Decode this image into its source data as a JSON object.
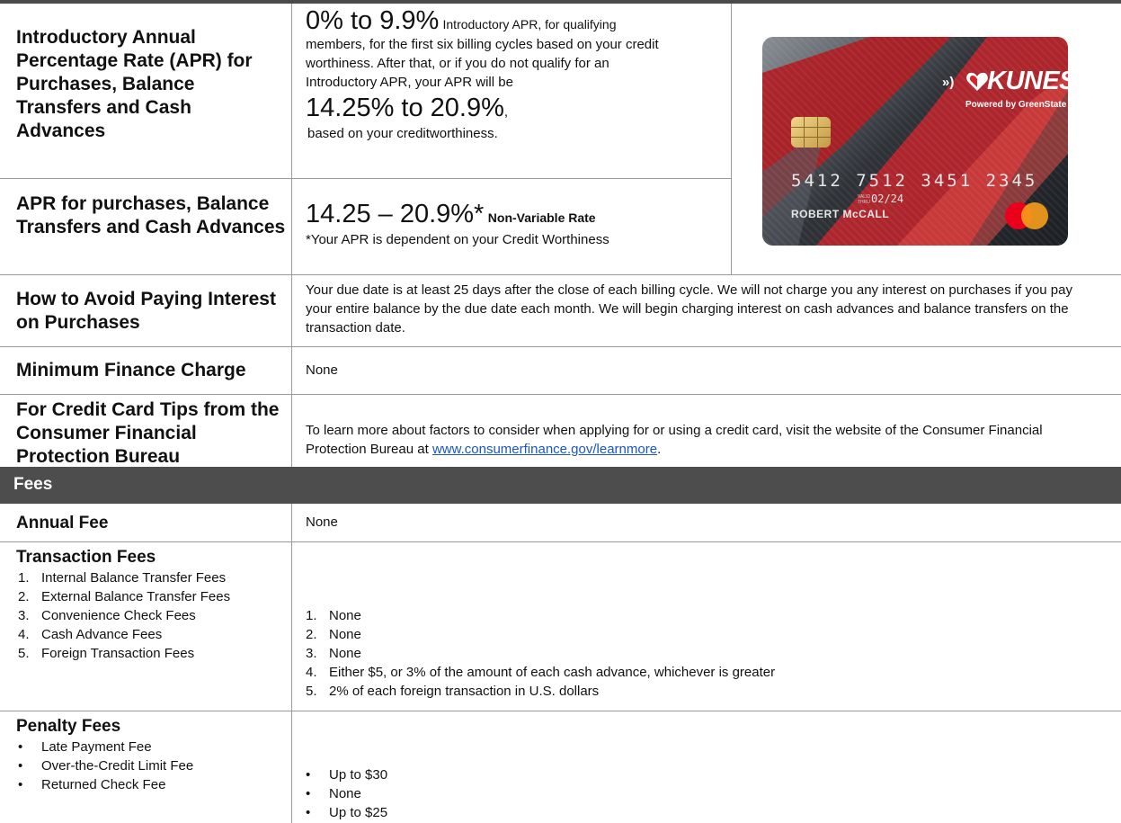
{
  "intro_apr": {
    "label": "Introductory Annual Percentage Rate (APR) for Purchases, Balance Transfers and Cash Advances",
    "rate": "0% to 9.9%",
    "text1": "Introductory APR, for qualifying",
    "text2": "members, for the first six billing cycles based on your credit",
    "text3": "worthiness. After that, or if you do not qualify for an",
    "text4": "Introductory APR, your APR will be",
    "rate2": "14.25% to 20.9%",
    "rate2_suffix": ",",
    "text5": "based on your creditworthiness."
  },
  "apr": {
    "label": "APR for purchases, Balance Transfers and Cash Advances",
    "rate": "14.25 – 20.9%*",
    "rate_note": "Non-Variable Rate",
    "footnote": "*Your APR is dependent on your Credit Worthiness"
  },
  "card": {
    "brand": "KUNES",
    "powered": "Powered by GreenState",
    "number": "5412 7512 3451 2345",
    "valid_label": "VALID THRU",
    "expiry": "02/24",
    "holder": "ROBERT McCALL"
  },
  "avoid_interest": {
    "label": "How to Avoid Paying Interest on Purchases",
    "text": "Your due date is at least 25 days after the close of each billing cycle. We will not charge you any interest on purchases if you pay your entire balance by the due date each month. We will begin charging interest on cash advances and balance transfers on the transaction date."
  },
  "min_finance": {
    "label": "Minimum Finance Charge",
    "value": "None"
  },
  "tips": {
    "label": "For Credit Card Tips from the Consumer Financial Protection Bureau",
    "text": "To learn more about factors to consider when applying for or using a credit card, visit the website of the Consumer Financial Protection Bureau at",
    "link": "www.consumerfinance.gov/learnmore",
    "end": "."
  },
  "fees_header": "Fees",
  "annual_fee": {
    "label": "Annual Fee",
    "value": "None"
  },
  "transaction_fees": {
    "label": "Transaction Fees",
    "items": [
      {
        "n": "1.",
        "name": "Internal Balance Transfer Fees",
        "value": "None"
      },
      {
        "n": "2.",
        "name": "External Balance Transfer Fees",
        "value": "None"
      },
      {
        "n": "3.",
        "name": "Convenience Check Fees",
        "value": "None"
      },
      {
        "n": "4.",
        "name": "Cash Advance Fees",
        "value": "Either $5, or 3% of the amount of each cash advance, whichever is greater"
      },
      {
        "n": "5.",
        "name": "Foreign Transaction Fees",
        "value": "2% of each foreign transaction in U.S. dollars"
      }
    ]
  },
  "penalty_fees": {
    "label": "Penalty Fees",
    "bullet": "•",
    "items": [
      {
        "name": "Late Payment Fee",
        "value": "Up to $30"
      },
      {
        "name": "Over-the-Credit Limit Fee",
        "value": "None"
      },
      {
        "name": "Returned Check Fee",
        "value": "Up to $25"
      }
    ]
  },
  "colors": {
    "header_bg": "#4d4d4d",
    "border": "#9a9a9a",
    "link": "#1a56c4",
    "card_red": "#d8232a"
  }
}
